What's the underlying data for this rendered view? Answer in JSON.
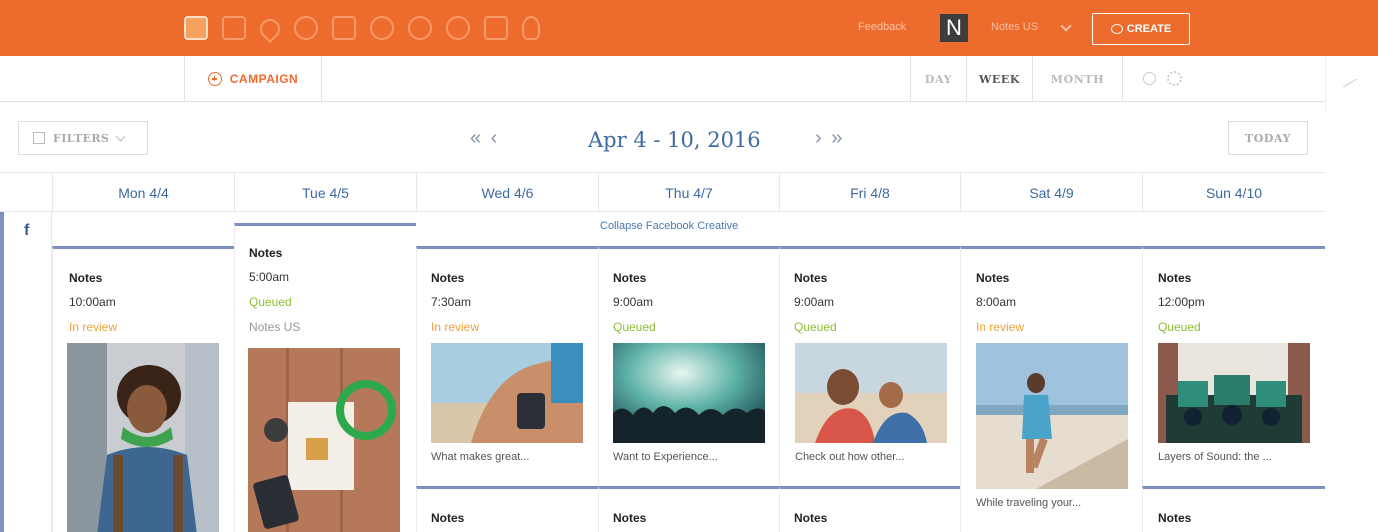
{
  "topbar": {
    "icons": [
      "calendar-icon",
      "checklist-icon",
      "drop-icon",
      "at-icon",
      "image-icon",
      "timer-icon",
      "brackets-icon",
      "check-circle-icon",
      "bar-chart-icon",
      "bulb-icon"
    ],
    "feedback": "Feedback",
    "logo_letter": "N",
    "brand": "Notes US",
    "create": "CREATE"
  },
  "toolbar": {
    "campaign": "CAMPAIGN",
    "views": [
      "DAY",
      "WEEK",
      "MONTH"
    ],
    "active_view": "WEEK"
  },
  "nav": {
    "filters": "FILTERS",
    "prev": "«  ‹",
    "date_range": "Apr 4 - 10, 2016",
    "next": "›  »",
    "today": "TODAY"
  },
  "days": [
    "Mon 4/4",
    "Tue 4/5",
    "Wed 4/6",
    "Thu 4/7",
    "Fri 4/8",
    "Sat 4/9",
    "Sun 4/10"
  ],
  "channel": {
    "icon": "f"
  },
  "collapse_label": "Collapse Facebook Creative",
  "colors": {
    "brand_orange": "#ec6b2d",
    "link_blue": "#3b6aa0",
    "queued": "#8cbf2f",
    "in_review": "#f0a23a",
    "channel_stripe": "#7e8fc2"
  },
  "posts": [
    {
      "title": "Notes",
      "time": "10:00am",
      "status": "In review",
      "caption": ""
    },
    {
      "title": "Notes",
      "time": "5:00am",
      "status": "Queued",
      "sub": "Notes US",
      "caption": ""
    },
    {
      "title": "Notes",
      "time": "7:30am",
      "status": "In review",
      "caption": "What makes great..."
    },
    {
      "title": "Notes",
      "time": "9:00am",
      "status": "Queued",
      "caption": "Want to Experience..."
    },
    {
      "title": "Notes",
      "time": "9:00am",
      "status": "Queued",
      "caption": "Check out how other..."
    },
    {
      "title": "Notes",
      "time": "8:00am",
      "status": "In review",
      "caption": "While traveling your..."
    },
    {
      "title": "Notes",
      "time": "12:00pm",
      "status": "Queued",
      "caption": "Layers of Sound: the ..."
    }
  ],
  "second_row": [
    "Notes",
    "Notes",
    "Notes",
    "Notes"
  ]
}
